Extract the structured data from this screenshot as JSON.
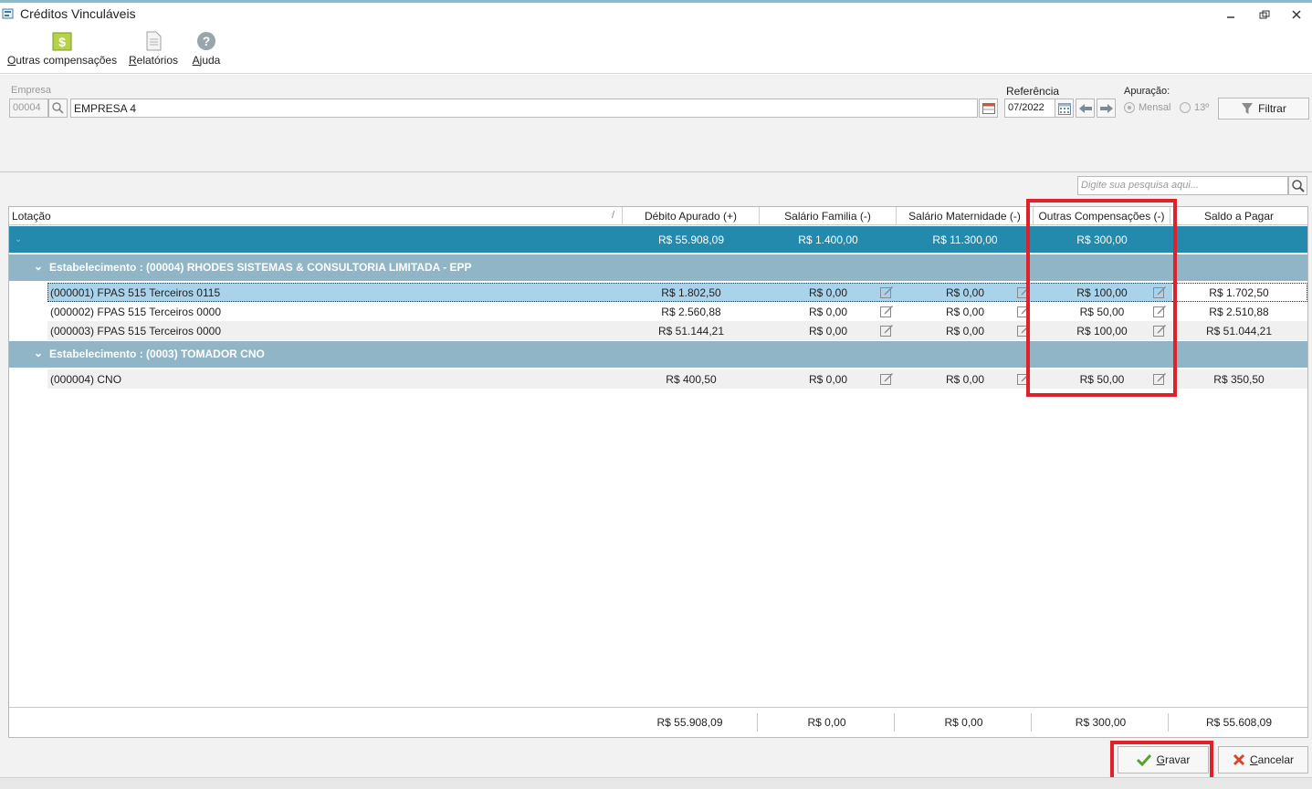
{
  "window": {
    "title": "Créditos Vinculáveis",
    "controls": [
      "minimize",
      "restore",
      "close"
    ]
  },
  "toolbar": {
    "items": [
      {
        "label": "Outras compensações",
        "icon": "dollar-icon"
      },
      {
        "label": "Relatórios",
        "icon": "report-icon"
      },
      {
        "label": "Ajuda",
        "icon": "help-icon"
      }
    ]
  },
  "filters": {
    "empresa_label": "Empresa",
    "empresa_code": "00004",
    "empresa_name": "EMPRESA 4",
    "referencia_label": "Referência",
    "referencia_value": "07/2022",
    "apuracao_label": "Apuração:",
    "apuracao_options": [
      {
        "label": "Mensal",
        "selected": true
      },
      {
        "label": "13º",
        "selected": false
      }
    ],
    "filtrar_label": "Filtrar"
  },
  "search": {
    "placeholder": "Digite sua pesquisa aqui..."
  },
  "grid": {
    "columns": [
      "Lotação",
      "Débito Apurado (+)",
      "Salário Familia (-)",
      "Salário Maternidade (-)",
      "Outras Compensações (-)",
      "Saldo a Pagar"
    ],
    "total_row": {
      "debito": "R$ 55.908,09",
      "salario_familia": "R$ 1.400,00",
      "salario_maternidade": "R$ 11.300,00",
      "outras_compensacoes": "R$ 300,00",
      "saldo": ""
    },
    "groups": [
      {
        "label": "Estabelecimento : (00004) RHODES SISTEMAS & CONSULTORIA LIMITADA - EPP",
        "rows": [
          {
            "lotacao": "(000001) FPAS 515 Terceiros 0115",
            "debito": "R$ 1.802,50",
            "salario_familia": "R$ 0,00",
            "salario_maternidade": "R$ 0,00",
            "outras_compensacoes": "R$ 100,00",
            "saldo": "R$ 1.702,50",
            "selected": true
          },
          {
            "lotacao": "(000002) FPAS 515 Terceiros 0000",
            "debito": "R$ 2.560,88",
            "salario_familia": "R$ 0,00",
            "salario_maternidade": "R$ 0,00",
            "outras_compensacoes": "R$ 50,00",
            "saldo": "R$ 2.510,88",
            "selected": false
          },
          {
            "lotacao": "(000003) FPAS 515 Terceiros 0000",
            "debito": "R$ 51.144,21",
            "salario_familia": "R$ 0,00",
            "salario_maternidade": "R$ 0,00",
            "outras_compensacoes": "R$ 100,00",
            "saldo": "R$ 51.044,21",
            "selected": false
          }
        ]
      },
      {
        "label": "Estabelecimento : (0003) TOMADOR CNO",
        "rows": [
          {
            "lotacao": "(000004) CNO",
            "debito": "R$ 400,50",
            "salario_familia": "R$ 0,00",
            "salario_maternidade": "R$ 0,00",
            "outras_compensacoes": "R$ 50,00",
            "saldo": "R$ 350,50",
            "selected": false
          }
        ]
      }
    ],
    "footer": {
      "debito": "R$ 55.908,09",
      "salario_familia": "R$ 0,00",
      "salario_maternidade": "R$ 0,00",
      "outras_compensacoes": "R$ 300,00",
      "saldo": "R$ 55.608,09"
    }
  },
  "actions": {
    "gravar_label": "Gravar",
    "cancelar_label": "Cancelar"
  },
  "colors": {
    "total_row": "#2389ad",
    "group_row": "#8fb5c6",
    "selected_row": "#a8d3ea",
    "highlight": "#e0202a"
  }
}
